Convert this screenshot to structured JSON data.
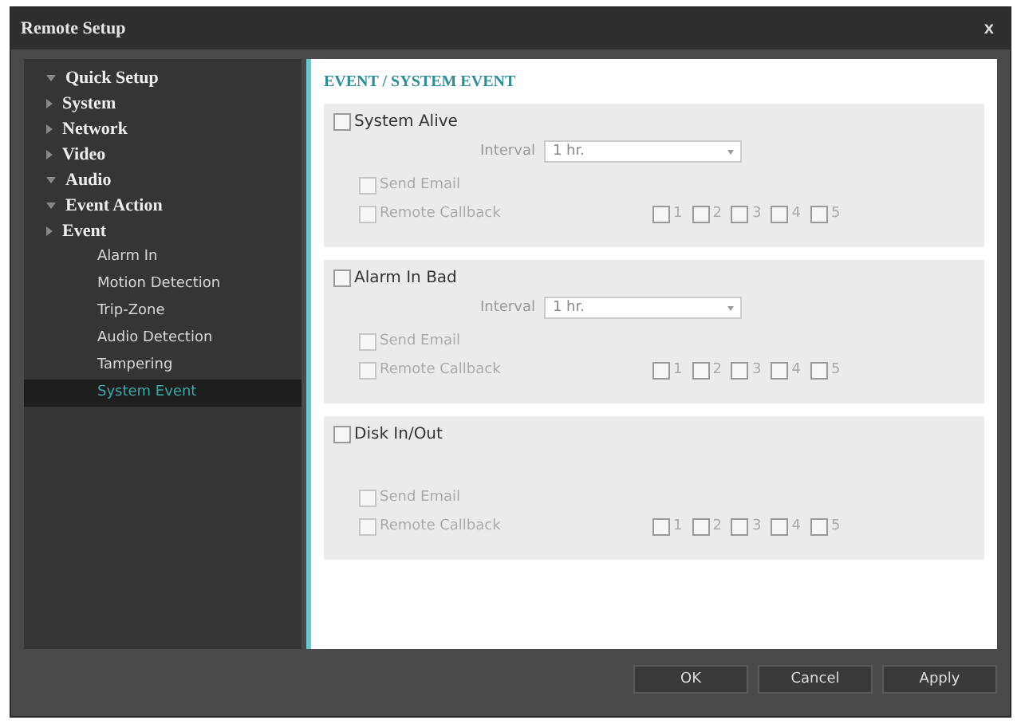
{
  "window": {
    "title": "Remote Setup",
    "close": "x"
  },
  "sidebar": {
    "items": [
      {
        "label": "Quick Setup",
        "expanded": true,
        "selected": false
      },
      {
        "label": "System",
        "expanded": false,
        "selected": false
      },
      {
        "label": "Network",
        "expanded": false,
        "selected": false
      },
      {
        "label": "Video",
        "expanded": false,
        "selected": false
      },
      {
        "label": "Audio",
        "expanded": true,
        "selected": false
      },
      {
        "label": "Event Action",
        "expanded": true,
        "selected": false
      },
      {
        "label": "Event",
        "expanded": false,
        "selected": false,
        "children": [
          {
            "label": "Alarm In",
            "selected": false
          },
          {
            "label": "Motion Detection",
            "selected": false
          },
          {
            "label": "Trip-Zone",
            "selected": false
          },
          {
            "label": "Audio Detection",
            "selected": false
          },
          {
            "label": "Tampering",
            "selected": false
          },
          {
            "label": "System Event",
            "selected": true
          }
        ]
      }
    ]
  },
  "content": {
    "heading": "EVENT / SYSTEM EVENT",
    "sections": [
      {
        "title": "System Alive",
        "checked": false,
        "interval": {
          "label": "Interval",
          "value": "1 hr."
        },
        "send_email": {
          "label": "Send Email",
          "checked": false,
          "disabled": true
        },
        "remote_callback": {
          "label": "Remote Callback",
          "checked": false,
          "disabled": true,
          "targets": [
            {
              "label": "1",
              "checked": false
            },
            {
              "label": "2",
              "checked": false
            },
            {
              "label": "3",
              "checked": false
            },
            {
              "label": "4",
              "checked": false
            },
            {
              "label": "5",
              "checked": false
            }
          ]
        }
      },
      {
        "title": "Alarm In Bad",
        "checked": false,
        "interval": {
          "label": "Interval",
          "value": "1 hr."
        },
        "send_email": {
          "label": "Send Email",
          "checked": false,
          "disabled": true
        },
        "remote_callback": {
          "label": "Remote Callback",
          "checked": false,
          "disabled": true,
          "targets": [
            {
              "label": "1",
              "checked": false
            },
            {
              "label": "2",
              "checked": false
            },
            {
              "label": "3",
              "checked": false
            },
            {
              "label": "4",
              "checked": false
            },
            {
              "label": "5",
              "checked": false
            }
          ]
        }
      },
      {
        "title": "Disk In/Out",
        "checked": false,
        "send_email": {
          "label": "Send Email",
          "checked": false,
          "disabled": true
        },
        "remote_callback": {
          "label": "Remote Callback",
          "checked": false,
          "disabled": true,
          "targets": [
            {
              "label": "1",
              "checked": false
            },
            {
              "label": "2",
              "checked": false
            },
            {
              "label": "3",
              "checked": false
            },
            {
              "label": "4",
              "checked": false
            },
            {
              "label": "5",
              "checked": false
            }
          ]
        }
      }
    ]
  },
  "buttons": [
    "OK",
    "Cancel",
    "Apply"
  ]
}
